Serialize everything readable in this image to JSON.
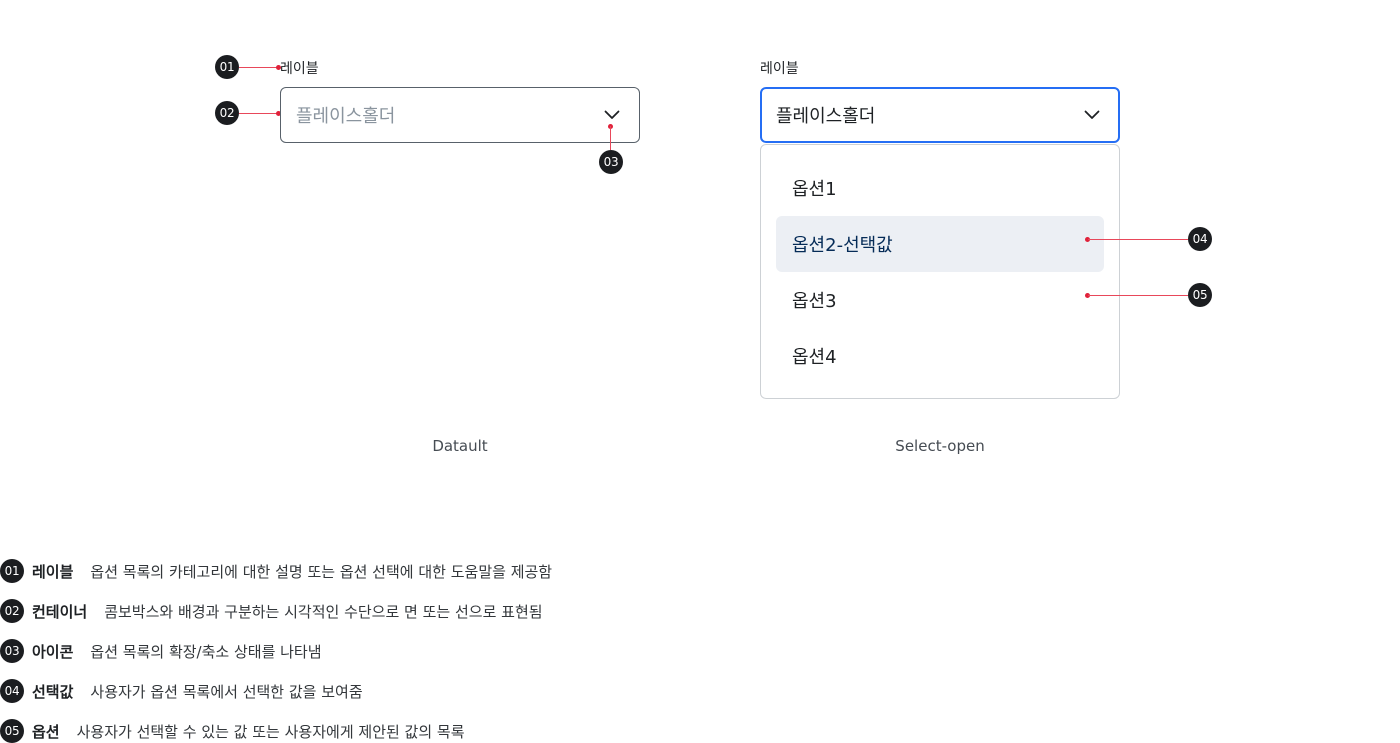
{
  "markers": [
    "01",
    "02",
    "03",
    "04",
    "05"
  ],
  "default_select": {
    "label": "레이블",
    "placeholder": "플레이스홀더",
    "caption": "Datault"
  },
  "open_select": {
    "label": "레이블",
    "value": "플레이스홀더",
    "caption": "Select-open",
    "options": [
      {
        "label": "옵션1",
        "selected": false
      },
      {
        "label": "옵션2-선택값",
        "selected": true
      },
      {
        "label": "옵션3",
        "selected": false
      },
      {
        "label": "옵션4",
        "selected": false
      }
    ]
  },
  "legend": [
    {
      "num": "01",
      "term": "레이블",
      "desc": "옵션 목록의 카테고리에 대한 설명 또는 옵션 선택에 대한 도움말을 제공함"
    },
    {
      "num": "02",
      "term": "컨테이너",
      "desc": "콤보박스와 배경과 구분하는 시각적인 수단으로 면 또는 선으로 표현됨"
    },
    {
      "num": "03",
      "term": "아이콘",
      "desc": "옵션 목록의 확장/축소 상태를 나타냄"
    },
    {
      "num": "04",
      "term": "선택값",
      "desc": "사용자가 옵션 목록에서 선택한 값을 보여줌"
    },
    {
      "num": "05",
      "term": "옵션",
      "desc": "사용자가 선택할 수 있는 값 또는 사용자에게 제안된 값의 목록"
    }
  ],
  "colors": {
    "accent": "#256ef4",
    "annotation": "#e0213a",
    "selected_bg": "#eceff4",
    "marker_bg": "#1b1d20"
  }
}
